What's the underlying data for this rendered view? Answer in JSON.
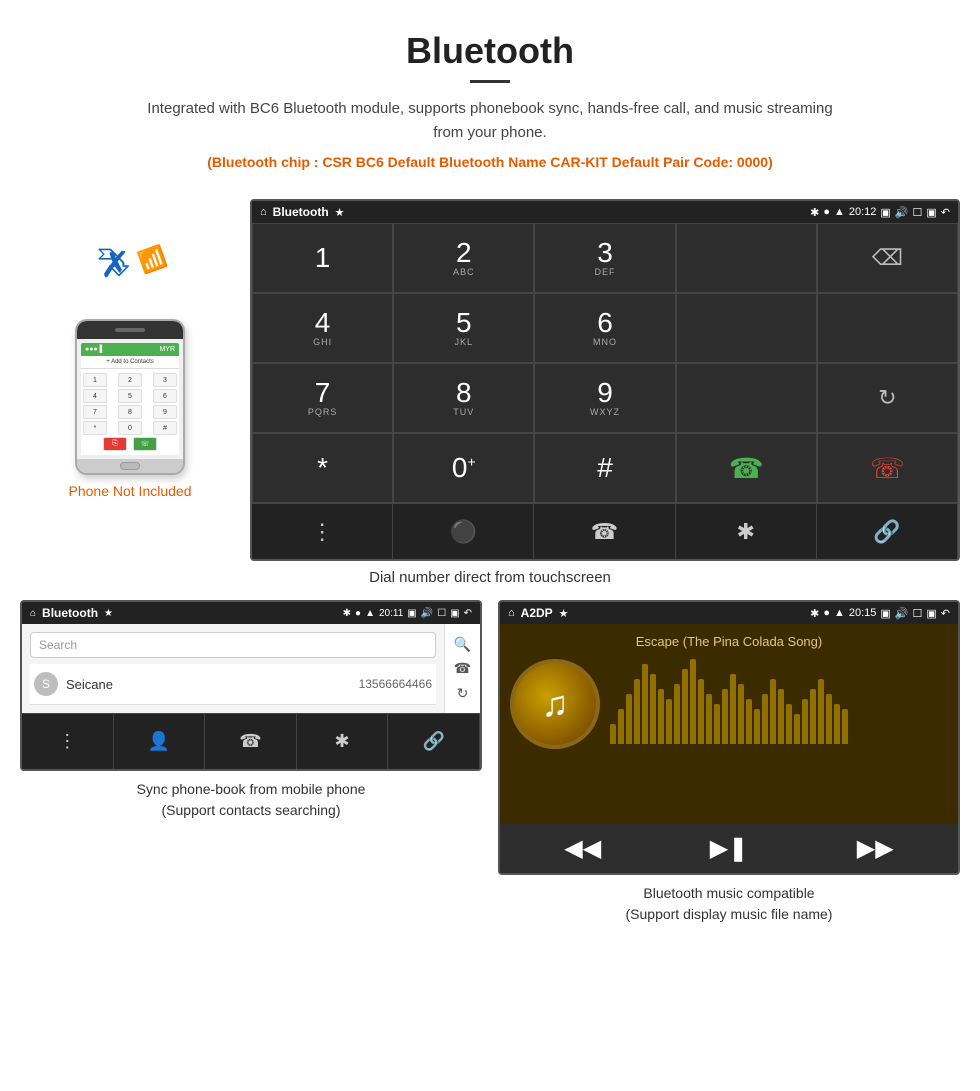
{
  "header": {
    "title": "Bluetooth",
    "description": "Integrated with BC6 Bluetooth module, supports phonebook sync, hands-free call, and music streaming from your phone.",
    "specs": "(Bluetooth chip : CSR BC6    Default Bluetooth Name CAR-KIT    Default Pair Code: 0000)"
  },
  "phone_label": "Phone Not Included",
  "dial_screen": {
    "status_bar": {
      "title": "Bluetooth",
      "time": "20:12",
      "icons": [
        "bt",
        "location",
        "signal",
        "usb"
      ]
    },
    "keys": [
      {
        "num": "1",
        "sub": ""
      },
      {
        "num": "2",
        "sub": "ABC"
      },
      {
        "num": "3",
        "sub": "DEF"
      },
      {
        "num": "",
        "sub": ""
      },
      {
        "num": "backspace",
        "sub": ""
      },
      {
        "num": "4",
        "sub": "GHI"
      },
      {
        "num": "5",
        "sub": "JKL"
      },
      {
        "num": "6",
        "sub": "MNO"
      },
      {
        "num": "",
        "sub": ""
      },
      {
        "num": "",
        "sub": ""
      },
      {
        "num": "7",
        "sub": "PQRS"
      },
      {
        "num": "8",
        "sub": "TUV"
      },
      {
        "num": "9",
        "sub": "WXYZ"
      },
      {
        "num": "",
        "sub": ""
      },
      {
        "num": "refresh",
        "sub": ""
      },
      {
        "num": "*",
        "sub": ""
      },
      {
        "num": "0+",
        "sub": ""
      },
      {
        "num": "#",
        "sub": ""
      },
      {
        "num": "call",
        "sub": ""
      },
      {
        "num": "hangup",
        "sub": ""
      }
    ],
    "nav": [
      "grid",
      "person",
      "phone",
      "bluetooth",
      "link"
    ]
  },
  "dial_caption": "Dial number direct from touchscreen",
  "phonebook_screen": {
    "status_bar": {
      "title": "Bluetooth",
      "time": "20:11"
    },
    "search_placeholder": "Search",
    "contacts": [
      {
        "letter": "S",
        "name": "Seicane",
        "phone": "13566664466"
      }
    ],
    "nav": [
      "grid",
      "person",
      "phone",
      "bluetooth",
      "link"
    ]
  },
  "phonebook_caption": "Sync phone-book from mobile phone\n(Support contacts searching)",
  "music_screen": {
    "status_bar": {
      "title": "A2DP",
      "time": "20:15"
    },
    "song_title": "Escape (The Pina Colada Song)",
    "controls": [
      "prev",
      "play-pause",
      "next"
    ],
    "bars": [
      20,
      35,
      50,
      65,
      80,
      70,
      55,
      45,
      60,
      75,
      85,
      65,
      50,
      40,
      55,
      70,
      60,
      45,
      35,
      50,
      65,
      55,
      40,
      30,
      45,
      55,
      65,
      50,
      40,
      35
    ]
  },
  "music_caption": "Bluetooth music compatible\n(Support display music file name)"
}
